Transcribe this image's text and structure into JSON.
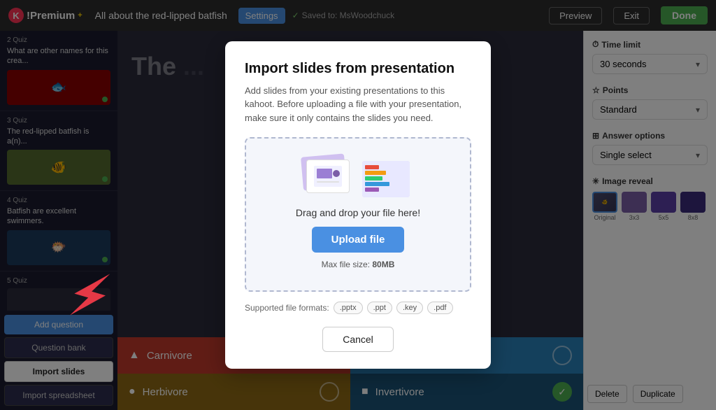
{
  "topbar": {
    "brand": "K!Premium+",
    "title": "All about the red-lipped batfish",
    "settings_label": "Settings",
    "saved_text": "Saved to: MsWoodchuck",
    "preview_label": "Preview",
    "exit_label": "Exit",
    "done_label": "Done"
  },
  "quiz_items": [
    {
      "number": "2",
      "type": "Quiz",
      "text": "What are other names for this crea..."
    },
    {
      "number": "3",
      "type": "Quiz",
      "text": "The red-lipped batfish is a(n)..."
    },
    {
      "number": "4",
      "type": "Quiz",
      "text": "Batfish are excellent swimmers."
    },
    {
      "number": "5",
      "type": "Quiz",
      "text": ""
    }
  ],
  "sidebar_buttons": {
    "add_question": "Add question",
    "question_bank": "Question bank",
    "import_slides": "Import slides",
    "import_spreadsheet": "Import spreadsheet"
  },
  "answer_options": [
    {
      "text": "Carnivore",
      "icon": "▲",
      "has_check": true
    },
    {
      "text": "",
      "icon": "◆",
      "has_check": false
    },
    {
      "text": "Herbivore",
      "icon": "●",
      "has_check": false
    },
    {
      "text": "Invertivore",
      "icon": "■",
      "has_check": true
    }
  ],
  "right_panel": {
    "time_limit_title": "Time limit",
    "time_limit_value": "30 seconds",
    "points_title": "Points",
    "points_value": "Standard",
    "answer_options_title": "Answer options",
    "answer_options_value": "Single select",
    "image_reveal_title": "Image reveal",
    "image_reveal_options": [
      "Original",
      "3x3",
      "5x5",
      "8x8"
    ],
    "delete_label": "Delete",
    "duplicate_label": "Duplicate"
  },
  "modal": {
    "title": "Import slides from presentation",
    "description": "Add slides from your existing presentations to this kahoot. Before uploading a file with your presentation, make sure it only contains the slides you need.",
    "dropzone_text": "Drag and drop your file here!",
    "upload_label": "Upload file",
    "maxsize_text": "Max file size:",
    "maxsize_value": "80MB",
    "formats_label": "Supported file formats:",
    "formats": [
      ".pptx",
      ".ppt",
      ".key",
      ".pdf"
    ],
    "cancel_label": "Cancel"
  }
}
